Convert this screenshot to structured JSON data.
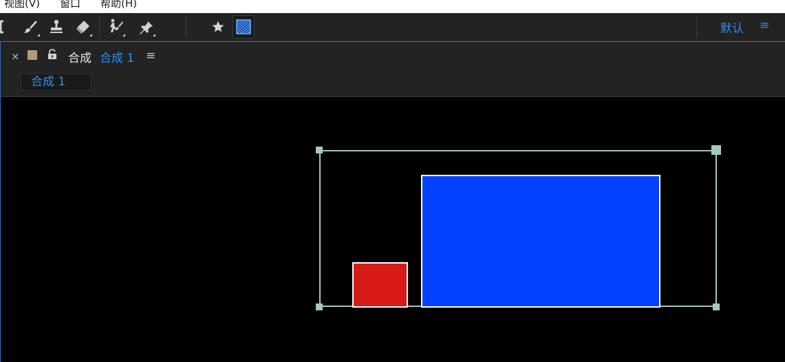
{
  "menubar": {
    "items": [
      "视图(V)",
      "窗口",
      "帮助(H)"
    ]
  },
  "toolbar": {
    "tools": [
      {
        "icon": "bracket-icon"
      },
      {
        "icon": "brush-icon"
      },
      {
        "icon": "clone-stamp-icon"
      },
      {
        "icon": "eraser-icon"
      },
      {
        "icon": "roto-brush-icon"
      },
      {
        "icon": "puppet-pin-icon"
      },
      {
        "icon": "star-icon"
      },
      {
        "icon": "transparency-grid-icon",
        "active": true
      }
    ],
    "workspace_label": "默认",
    "workspace_menu": "≡"
  },
  "panel": {
    "close": "×",
    "label_color": "#b39a7a",
    "title_prefix": "合成",
    "comp_name": "合成 1",
    "menu": "≡",
    "subtab_label": "合成 1"
  },
  "viewer": {
    "background": "#000000",
    "layers": [
      {
        "name": "red-solid",
        "color": "#d61b18"
      },
      {
        "name": "blue-solid",
        "color": "#0440ff"
      }
    ],
    "selection_color": "#a7c7c2"
  },
  "colors": {
    "accent": "#2d8ceb",
    "panel_bg": "#232323"
  }
}
